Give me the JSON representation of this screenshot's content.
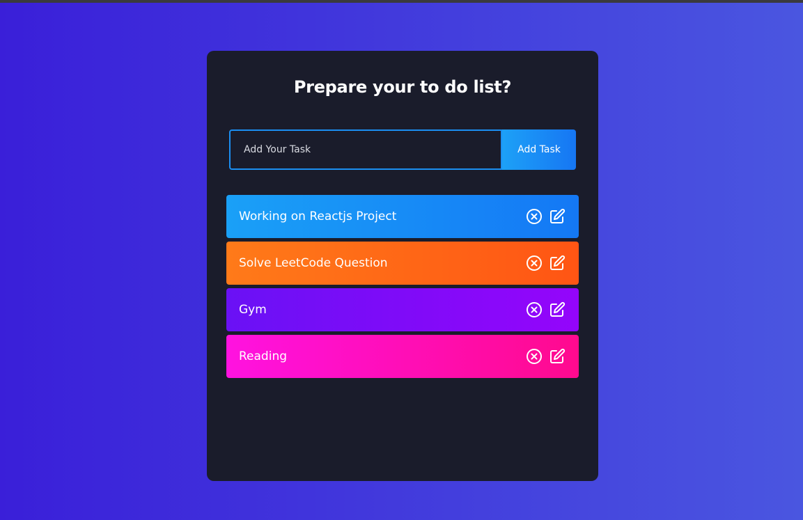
{
  "title": "Prepare your to do list?",
  "form": {
    "input_placeholder": "Add Your Task",
    "input_value": "",
    "add_button_label": "Add Task"
  },
  "tasks": [
    {
      "text": "Working on Reactjs Project",
      "gradient_start": "#1aa0f7",
      "gradient_end": "#1478f5"
    },
    {
      "text": "Solve LeetCode Question",
      "gradient_start": "#ff7a19",
      "gradient_end": "#ff5514"
    },
    {
      "text": "Gym",
      "gradient_start": "#6a11f5",
      "gradient_end": "#9405fb"
    },
    {
      "text": "Reading",
      "gradient_start": "#ff12e0",
      "gradient_end": "#ff0a8e"
    }
  ],
  "icons": {
    "delete": "close-circle-icon",
    "edit": "edit-icon"
  },
  "colors": {
    "background_start": "#3a1fd9",
    "background_end": "#4a56e0",
    "card": "#1a1c2b",
    "input_border": "#1b8ff2"
  }
}
